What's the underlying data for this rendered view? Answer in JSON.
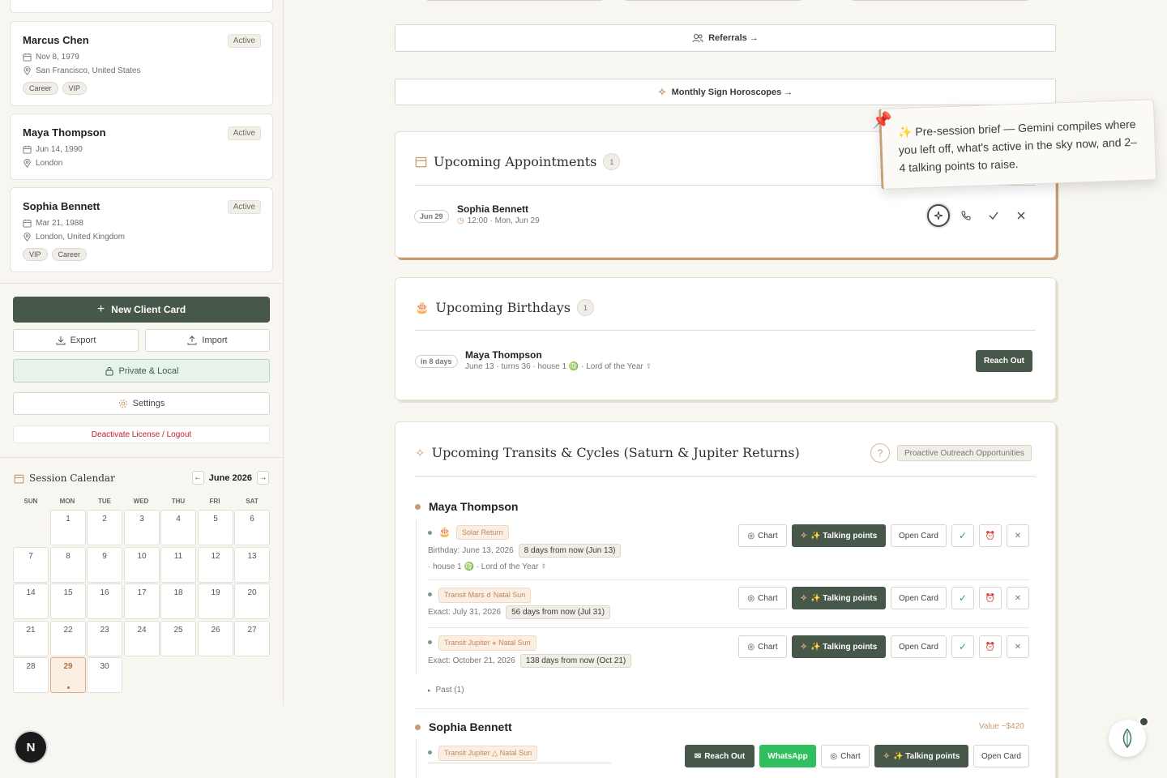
{
  "sidebar": {
    "clients": [
      {
        "name": "Marcus Chen",
        "status": "Active",
        "dob": "Nov 8, 1979",
        "location": "San Francisco, United States",
        "tags": [
          "Career",
          "VIP"
        ]
      },
      {
        "name": "Maya Thompson",
        "status": "Active",
        "dob": "Jun 14, 1990",
        "location": "London",
        "tags": []
      },
      {
        "name": "Sophia Bennett",
        "status": "Active",
        "dob": "Mar 21, 1988",
        "location": "London, United Kingdom",
        "tags": [
          "VIP",
          "Career"
        ]
      }
    ],
    "new_client_label": "New Client Card",
    "export_label": "Export",
    "import_label": "Import",
    "private_label": "Private & Local",
    "settings_label": "Settings",
    "logout_label": "Deactivate License / Logout"
  },
  "calendar": {
    "title": "Session Calendar",
    "month": "June 2026",
    "prev": "←",
    "next": "→",
    "weekdays": [
      "SUN",
      "MON",
      "TUE",
      "WED",
      "THU",
      "FRI",
      "SAT"
    ],
    "days": [
      "1",
      "2",
      "3",
      "4",
      "5",
      "6",
      "7",
      "8",
      "9",
      "10",
      "11",
      "12",
      "13",
      "14",
      "15",
      "16",
      "17",
      "18",
      "19",
      "20",
      "21",
      "22",
      "23",
      "24",
      "25",
      "26",
      "27",
      "28",
      "29",
      "30"
    ],
    "today": "29"
  },
  "next_badge": "N",
  "main": {
    "referrals_label": "Referrals →",
    "horoscopes_label": "Monthly Sign Horoscopes →",
    "appointments": {
      "title": "Upcoming Appointments",
      "count": "1",
      "item": {
        "date": "Jun 29",
        "name": "Sophia Bennett",
        "time": "12:00 · Mon, Jun 29"
      }
    },
    "tooltip": {
      "icon": "✨",
      "text": "Pre-session brief — Gemini compiles where you left off, what's active in the sky now, and 2–4 talking points to raise."
    },
    "birthdays": {
      "title": "Upcoming Birthdays",
      "count": "1",
      "item": {
        "when": "in 8 days",
        "name": "Maya Thompson",
        "detail": "June 13 · turns 36 · house 1 ♍ · Lord of the Year ☿",
        "action": "Reach Out"
      }
    },
    "transits": {
      "title": "Upcoming Transits & Cycles (Saturn & Jupiter Returns)",
      "badge": "Proactive Outreach Opportunities",
      "people": [
        {
          "name": "Maya Thompson",
          "events": [
            {
              "tag": "Solar Return",
              "label": "Birthday: June 13, 2026",
              "days": "8 days from now (Jun 13)",
              "extra": "· house 1 ♍ · Lord of the Year ☿"
            },
            {
              "tag": "Transit Mars ☌ Natal Sun",
              "label": "Exact: July 31, 2026",
              "days": "56 days from now (Jul 31)"
            },
            {
              "tag": "Transit Jupiter ⚹ Natal Sun",
              "label": "Exact: October 21, 2026",
              "days": "138 days from now (Oct 21)"
            }
          ],
          "past": "Past (1)"
        },
        {
          "name": "Sophia Bennett",
          "value": "Value ~$420",
          "events": [
            {
              "tag": "Transit Jupiter △ Natal Sun"
            }
          ]
        }
      ],
      "actions": {
        "chart": "Chart",
        "talking": "✨ Talking points",
        "open": "Open Card",
        "reach": "Reach Out",
        "whatsapp": "WhatsApp",
        "check": "✓",
        "alarm": "⏰",
        "close": "✕"
      }
    }
  },
  "colors": {
    "primary": "#47574a",
    "accent": "#c99a70",
    "danger": "#c0202a",
    "whatsapp": "#2fbf5e"
  }
}
